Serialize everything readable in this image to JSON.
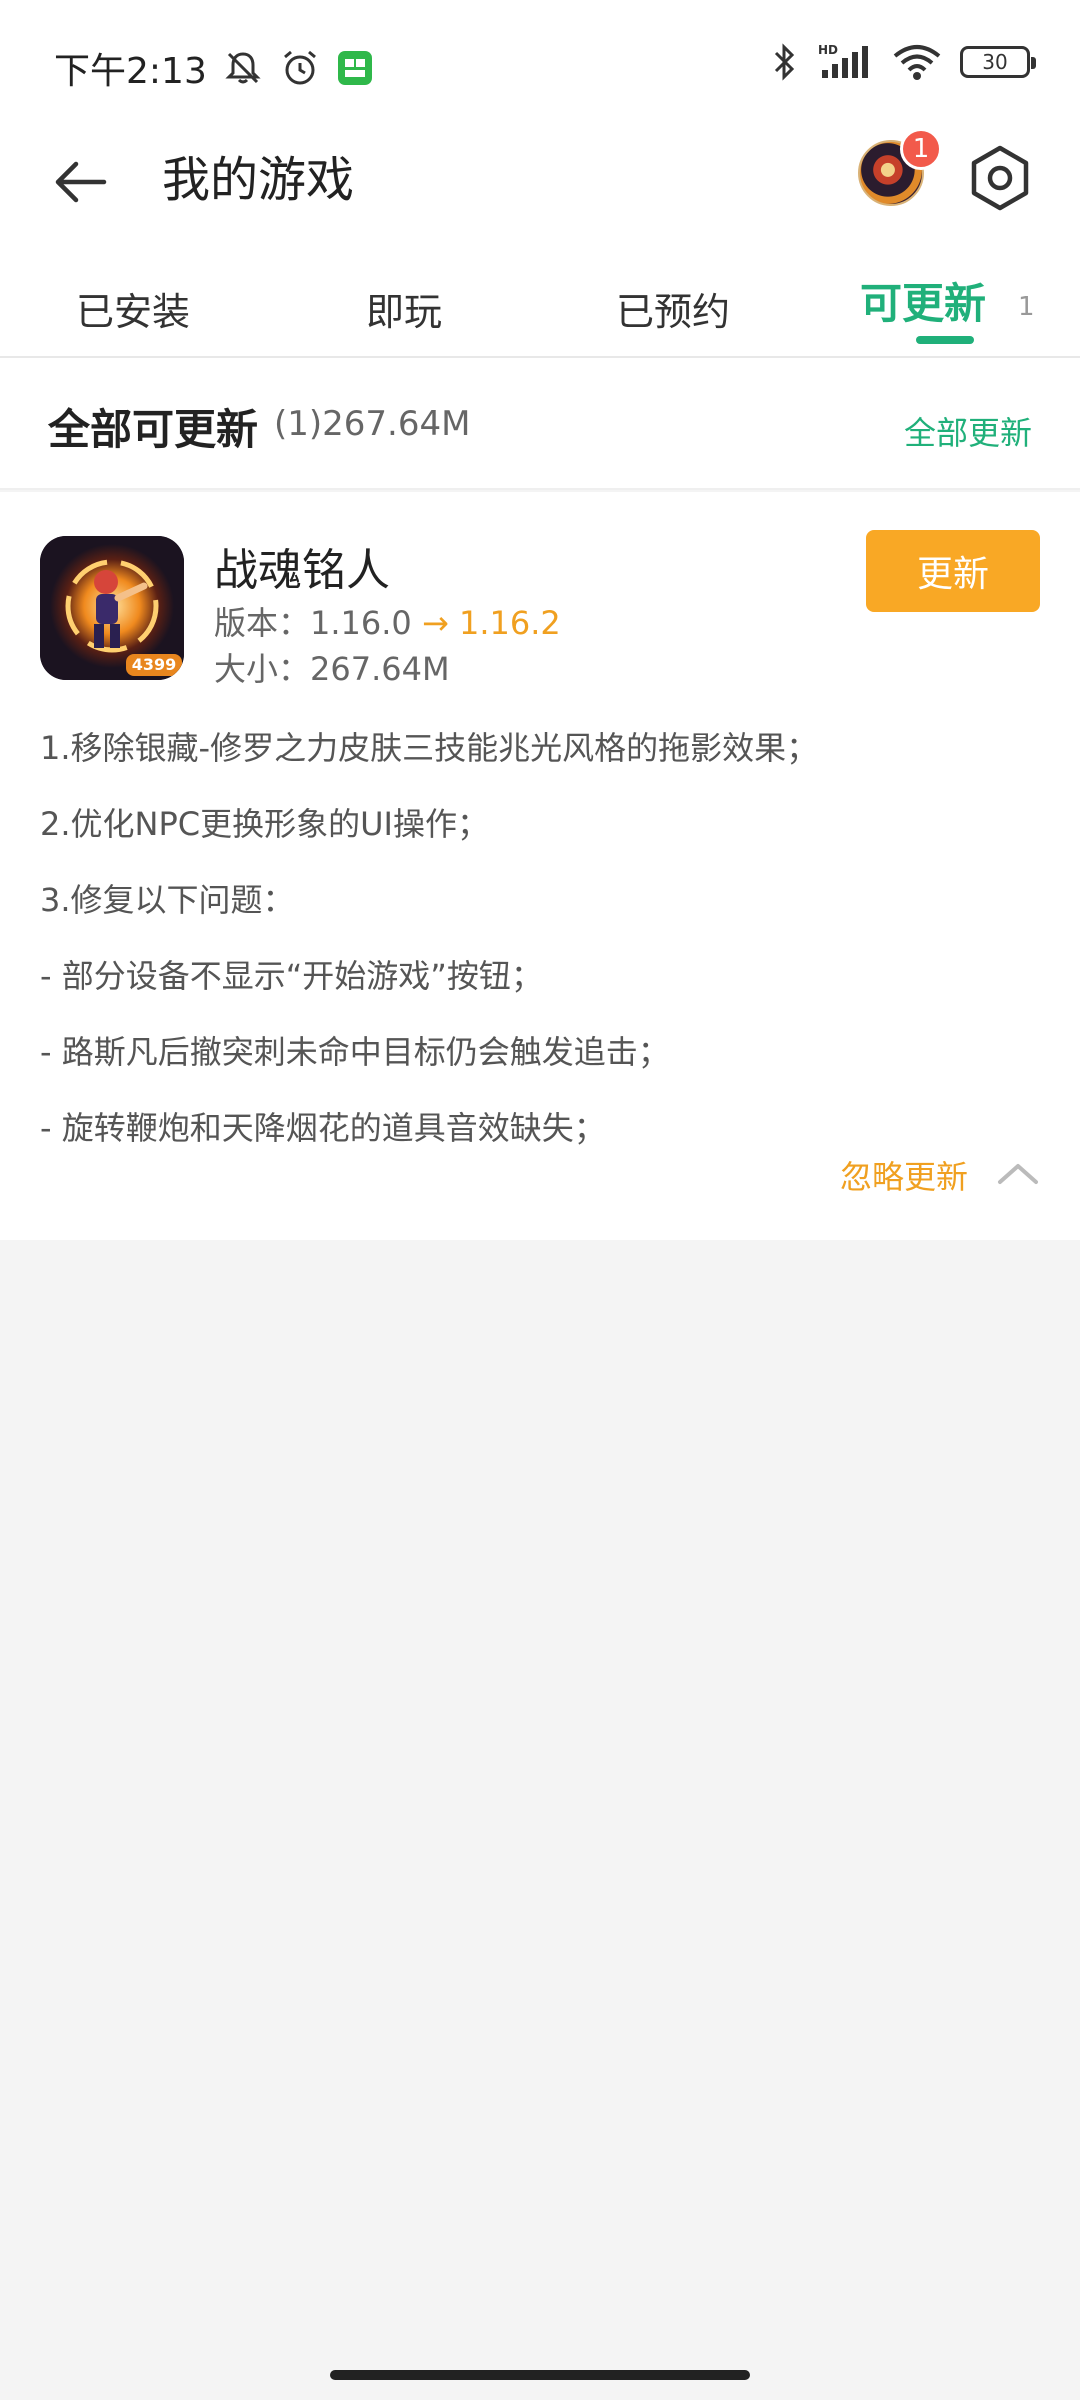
{
  "status_bar": {
    "time": "下午2:13",
    "icons": [
      "mute-bell-icon",
      "alarm-icon",
      "app-notification-icon",
      "bluetooth-icon",
      "hd-signal-icon",
      "wifi-icon"
    ],
    "battery": "30"
  },
  "header": {
    "title": "我的游戏",
    "badge_count": "1"
  },
  "tabs": [
    {
      "label": "已安装"
    },
    {
      "label": "即玩"
    },
    {
      "label": "已预约"
    },
    {
      "label": "可更新",
      "count": "1",
      "active": true
    }
  ],
  "summary": {
    "title": "全部可更新",
    "meta": "(1)267.64M",
    "update_all": "全部更新"
  },
  "game": {
    "name": "战魂铭人",
    "version_label": "版本：1.16.0",
    "arrow": "→",
    "new_version": "1.16.2",
    "size": "大小：267.64M",
    "icon_badge": "4399",
    "update_button": "更新",
    "notes": [
      "1.移除银藏-修罗之力皮肤三技能兆光风格的拖影效果；",
      "2.优化NPC更换形象的UI操作；",
      "3.修复以下问题：",
      "- 部分设备不显示“开始游戏”按钮；",
      "- 路斯凡后撤突刺未命中目标仍会触发追击；",
      "- 旋转鞭炮和天降烟花的道具音效缺失；"
    ],
    "ignore_update": "忽略更新"
  },
  "colors": {
    "accent_green": "#20b07a",
    "accent_orange": "#f9a825",
    "badge_red": "#f25a4b"
  }
}
